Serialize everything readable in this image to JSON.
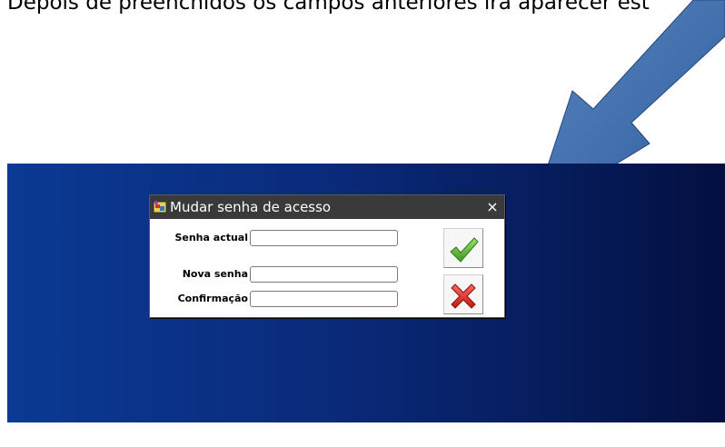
{
  "caption": "Depois de preenchidos os campos anteriores irá aparecer est",
  "dialog": {
    "title": "Mudar senha de acesso",
    "close_glyph": "×",
    "icon": "app-window-icon"
  },
  "fields": {
    "current_password": {
      "label": "Senha actual",
      "value": ""
    },
    "new_password": {
      "label": "Nova senha",
      "value": ""
    },
    "confirmation": {
      "label": "Confirmação",
      "value": ""
    }
  },
  "buttons": {
    "confirm_icon": "checkmark-icon",
    "cancel_icon": "red-x-icon"
  },
  "colors": {
    "arrow": "#3e6fb0",
    "desktop": "#0a2a7a",
    "titlebar": "#3a3a3a",
    "confirm": "#5cb82e",
    "cancel": "#d42020"
  }
}
